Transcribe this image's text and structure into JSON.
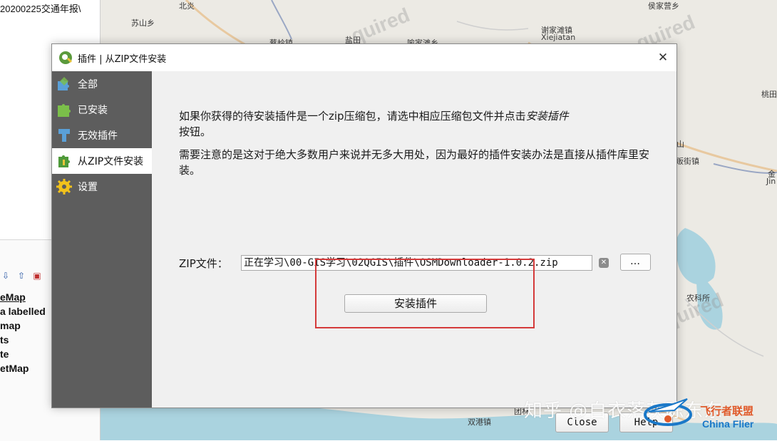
{
  "background": {
    "left_panel": {
      "path_text": "20200225交通年报\\",
      "layer_items": [
        "eMap",
        "a labelled",
        "map",
        "ts",
        "te",
        "etMap"
      ]
    },
    "map_labels": [
      {
        "text": "北炎"
      },
      {
        "text": "苏山乡"
      },
      {
        "text": "蔡岭镇"
      },
      {
        "text": "盐田"
      },
      {
        "text": "喻家滩乡"
      },
      {
        "text": "谢家滩镇"
      },
      {
        "text": "Xiejiatan"
      },
      {
        "text": "侯家营乡"
      },
      {
        "text": "桃田"
      },
      {
        "text": "山"
      },
      {
        "text": "贩街镇"
      },
      {
        "text": "金"
      },
      {
        "text": "Jin"
      },
      {
        "text": "农科所"
      },
      {
        "text": "团林"
      },
      {
        "text": "双港镇"
      }
    ],
    "watermark_text": "quired",
    "colors": {
      "map_bg": "#eceae4",
      "water": "#aad3df",
      "road": "#e8c9a0"
    }
  },
  "dialog": {
    "title": "插件 | 从ZIP文件安装",
    "close_glyph": "✕",
    "sidebar": [
      {
        "label": "全部",
        "icon": "puzzle-all-icon",
        "active": false
      },
      {
        "label": "已安装",
        "icon": "puzzle-installed-icon",
        "active": false
      },
      {
        "label": "无效插件",
        "icon": "invalid-plugin-icon",
        "active": false
      },
      {
        "label": "从ZIP文件安装",
        "icon": "zip-install-icon",
        "active": true
      },
      {
        "label": "设置",
        "icon": "gear-icon",
        "active": false
      }
    ],
    "content": {
      "para1_part1": "如果你获得的待安装插件是一个zip压缩包，请选中相应压缩包文件并点击",
      "para1_emph": "安装插件",
      "para1_part2": "按钮。",
      "para2": "需要注意的是这对于绝大多数用户来说并无多大用处，因为最好的插件安装办法是直接从插件库里安装。",
      "zip_label": "ZIP文件：",
      "zip_value": "正在学习\\00-GIS学习\\02QGIS\\插件\\OSMDownloader-1.0.2.zip",
      "browse_label": "…",
      "install_label": "安装插件",
      "close_label": "Close",
      "help_label": "Help",
      "highlight_color": "#d43a3a"
    }
  },
  "overlay": {
    "zhihu_text": "知乎 @自衣落灰陈东东",
    "flier_cn": "飞行者联盟",
    "flier_en": "China Flier"
  }
}
